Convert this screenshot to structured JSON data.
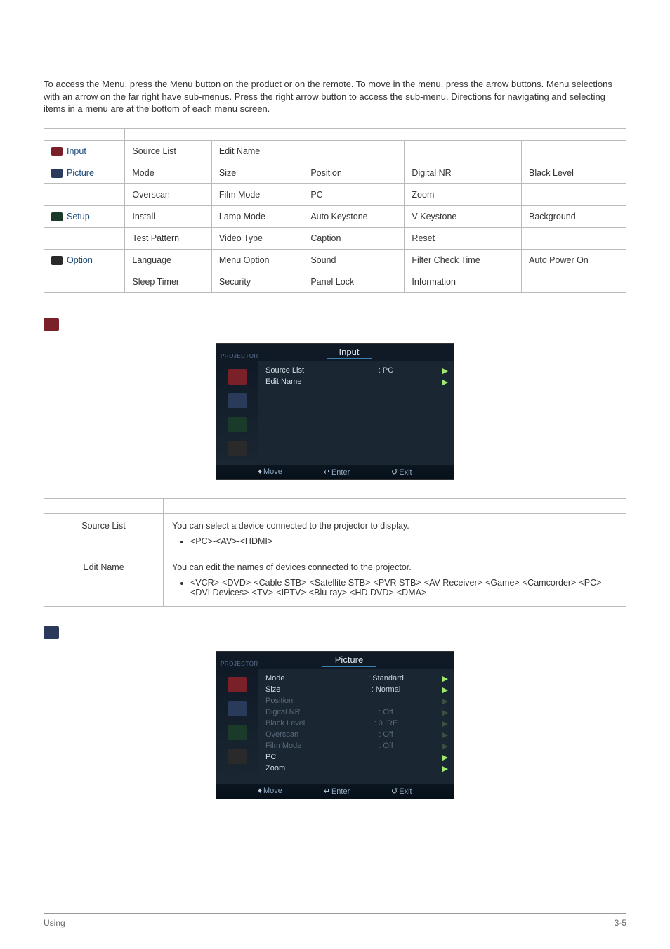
{
  "intro_text": "To access the Menu, press the Menu button on the product or on the remote. To move in the menu, press the arrow buttons. Menu selections with an arrow on the far right have sub-menus. Press the right arrow button to access the sub-menu. Directions for navigating and selecting items in a menu are at the bottom of each menu screen.",
  "menu_table": {
    "rows": [
      {
        "category_icon": "ico-input",
        "category": "Input",
        "cells": [
          "Source List",
          "Edit Name",
          "",
          "",
          ""
        ]
      },
      {
        "category_icon": "ico-picture",
        "category": "Picture",
        "cells": [
          "Mode",
          "Size",
          "Position",
          "Digital NR",
          "Black Level"
        ]
      },
      {
        "category_icon": "",
        "category": "",
        "cells": [
          "Overscan",
          "Film Mode",
          "PC",
          "Zoom",
          ""
        ]
      },
      {
        "category_icon": "ico-setup",
        "category": "Setup",
        "cells": [
          "Install",
          "Lamp Mode",
          "Auto Keystone",
          "V-Keystone",
          "Background"
        ]
      },
      {
        "category_icon": "",
        "category": "",
        "cells": [
          "Test Pattern",
          "Video Type",
          "Caption",
          "Reset",
          ""
        ]
      },
      {
        "category_icon": "ico-option",
        "category": "Option",
        "cells": [
          "Language",
          "Menu Option",
          "Sound",
          "Filter Check Time",
          "Auto Power On"
        ]
      },
      {
        "category_icon": "",
        "category": "",
        "cells": [
          "Sleep Timer",
          "Security",
          "Panel Lock",
          "Information",
          ""
        ]
      }
    ]
  },
  "osd_input": {
    "logo": "PROJECTOR",
    "title": "Input",
    "tabs_colors": [
      "#7a2028",
      "#2a3a5a",
      "#1a3a2a",
      "#2a2a2a"
    ],
    "rows": [
      {
        "label": "Source List",
        "value": ": PC",
        "arrow": true
      },
      {
        "label": "Edit Name",
        "value": "",
        "arrow": true
      }
    ],
    "foot": {
      "move": "Move",
      "enter": "Enter",
      "exit": "Exit"
    }
  },
  "desc_input": {
    "rows": [
      {
        "name": "Source List",
        "text": "You can select a device connected to the projector to display.",
        "bullets": [
          "<PC>-<AV>-<HDMI>"
        ]
      },
      {
        "name": "Edit Name",
        "text": "You can edit the names of devices connected to the projector.",
        "bullets": [
          "<VCR>-<DVD>-<Cable STB>-<Satellite STB>-<PVR STB>-<AV Receiver>-<Game>-<Camcorder>-<PC>-<DVI Devices>-<TV>-<IPTV>-<Blu-ray>-<HD DVD>-<DMA>"
        ]
      }
    ]
  },
  "osd_picture": {
    "logo": "PROJECTOR",
    "title": "Picture",
    "tabs_colors": [
      "#7a2028",
      "#2a3a5a",
      "#1a3a2a",
      "#2a2a2a"
    ],
    "rows": [
      {
        "label": "Mode",
        "value": ": Standard",
        "arrow": true,
        "dim": false
      },
      {
        "label": "Size",
        "value": ": Normal",
        "arrow": true,
        "dim": false
      },
      {
        "label": "Position",
        "value": "",
        "arrow": true,
        "dim": true
      },
      {
        "label": "Digital NR",
        "value": ": Off",
        "arrow": true,
        "dim": true
      },
      {
        "label": "Black Level",
        "value": ": 0 IRE",
        "arrow": true,
        "dim": true
      },
      {
        "label": "Overscan",
        "value": ": Off",
        "arrow": true,
        "dim": true
      },
      {
        "label": "Film Mode",
        "value": ": Off",
        "arrow": true,
        "dim": true
      },
      {
        "label": "PC",
        "value": "",
        "arrow": true,
        "dim": false
      },
      {
        "label": "Zoom",
        "value": "",
        "arrow": true,
        "dim": false
      }
    ],
    "foot": {
      "move": "Move",
      "enter": "Enter",
      "exit": "Exit"
    }
  },
  "footer": {
    "left": "Using",
    "right": "3-5"
  }
}
